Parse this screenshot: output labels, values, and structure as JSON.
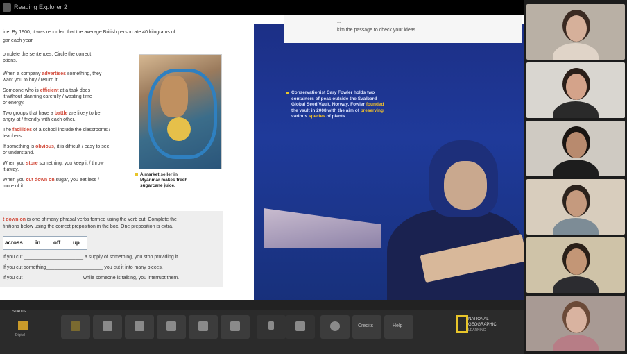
{
  "window": {
    "title": "Reading Explorer 2"
  },
  "left_page": {
    "top_lines": [
      "ide. By 1900, it was recorded that the average British person ate 40 kilograms of",
      "gar each year."
    ],
    "instructions": [
      "omplete the sentences. Circle the correct",
      "ptions."
    ],
    "items": [
      {
        "pre": "When a company ",
        "word": "advertises",
        "post": " something, they",
        "line2": "want you to buy / return it."
      },
      {
        "pre": "Someone who is ",
        "word": "efficient",
        "post": " at a task does",
        "line2": "it without planning carefully / wasting time",
        "line3": "or energy."
      },
      {
        "pre": "Two groups that have a ",
        "word": "battle",
        "post": " are likely to be",
        "line2": "angry at / friendly with each other."
      },
      {
        "pre": "The ",
        "word": "facilities",
        "post": " of a school include the classrooms /",
        "line2": "teachers."
      },
      {
        "pre": "If something is ",
        "word": "obvious",
        "post": ", it is difficult / easy to see",
        "line2": "or understand."
      },
      {
        "pre": "When you ",
        "word": "store",
        "post": " something, you keep it / throw",
        "line2": "it away."
      },
      {
        "pre": "When you ",
        "word": "cut down on",
        "post": " sugar, you eat less /",
        "line2": "more of it."
      }
    ],
    "photo_caption": [
      "A market seller in",
      "Myanmar makes fresh",
      "sugarcane juice."
    ],
    "phrasal": {
      "line1_word": "t down on",
      "line1_rest": " is one of many phrasal verbs formed using the verb cut. Complete the",
      "line2": "finitions below using the correct preposition in the box. One preposition is extra.",
      "words": [
        "across",
        "in",
        "off",
        "up"
      ],
      "sentences": [
        "If you cut ______________________ a supply of something, you stop providing it.",
        "If you cut something_____________________ you cut it into many pieces.",
        "If you cut______________________ while someone is talking, you interrupt them."
      ]
    }
  },
  "right_page": {
    "top_box": [
      "...",
      "kim the passage to check your ideas."
    ],
    "quote": {
      "l1": "Conservationist Cary Fowler holds two",
      "l2": "containers of peas outside the Svalbard",
      "l3a": "Global Seed Vault, Norway. Fowler ",
      "l3h": "founded",
      "l4a": "the vault in 2008 with the aim of ",
      "l4h": "preserving",
      "l5a": "various ",
      "l5h": "species",
      "l5b": " of plants."
    }
  },
  "toolbar": {
    "status_label": "STATUS",
    "status_sub": "Digital",
    "buttons": [
      "pages-icon",
      "comment-icon",
      "gallery-icon",
      "eraser-icon",
      "pen-icon",
      "highlighter-icon",
      "pointer-icon",
      "screen-icon",
      "settings-icon",
      "credits-label",
      "help-label"
    ],
    "credits_label": "Credits",
    "help_label": "Help",
    "brand": [
      "NATIONAL",
      "GEOGRAPHIC",
      "LEARNING"
    ]
  },
  "participants": [
    {
      "name": "participant-1",
      "bg": "#b9b0a5",
      "skin": "#d6b09a",
      "hair": "#3a2a22",
      "shirt": "#e0d4c8"
    },
    {
      "name": "participant-2",
      "bg": "#d9d6d0",
      "skin": "#d4a38a",
      "hair": "#2a1e18",
      "shirt": "#2a2a2a"
    },
    {
      "name": "participant-3",
      "bg": "#cfcac2",
      "skin": "#b88a6e",
      "hair": "#1a1512",
      "shirt": "#1d1d1d"
    },
    {
      "name": "participant-4",
      "bg": "#d8cdbd",
      "skin": "#c59a7e",
      "hair": "#2b221c",
      "shirt": "#7d8c96"
    },
    {
      "name": "participant-5",
      "bg": "#cfc3a8",
      "skin": "#c39676",
      "hair": "#2a2018",
      "shirt": "#2c2c30"
    },
    {
      "name": "participant-6",
      "bg": "#a89a94",
      "skin": "#d9b3a0",
      "hair": "#6b4a38",
      "shirt": "#b77d86"
    }
  ]
}
